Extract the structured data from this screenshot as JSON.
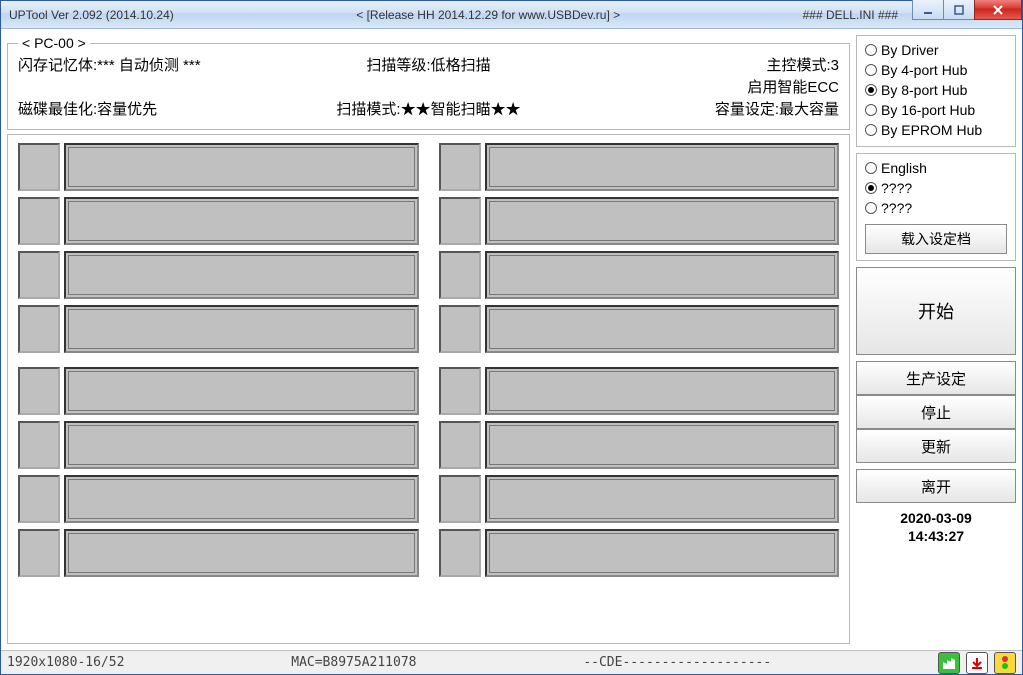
{
  "titlebar": {
    "left": "UPTool Ver 2.092 (2014.10.24)",
    "center": "< [Release HH 2014.12.29 for www.USBDev.ru] >",
    "right": "### DELL.INI ###"
  },
  "header": {
    "legend": "< PC-00 >",
    "flash_mem": "闪存记忆体:*** 自动侦测 ***",
    "scan_level": "扫描等级:低格扫描",
    "master_mode": "主控模式:3",
    "disk_opt": "磁碟最佳化:容量优先",
    "scan_mode": "扫描模式:★★智能扫瞄★★",
    "enable_ecc": "启用智能ECC",
    "capacity": "容量设定:最大容量"
  },
  "topology": {
    "options": [
      "By Driver",
      "By 4-port Hub",
      "By 8-port Hub",
      "By 16-port Hub",
      "By EPROM Hub"
    ],
    "selected": 2
  },
  "language": {
    "options": [
      "English",
      "????",
      "????"
    ],
    "selected": 1
  },
  "buttons": {
    "load_config": "载入设定档",
    "start": "开始",
    "prod": "生产设定",
    "stop": "停止",
    "refresh": "更新",
    "exit": "离开"
  },
  "timestamp": {
    "date": "2020-03-09",
    "time": "14:43:27"
  },
  "status": {
    "res": "1920x1080-16/52",
    "mac": "MAC=B8975A211078",
    "cde": "--CDE-------------------"
  }
}
